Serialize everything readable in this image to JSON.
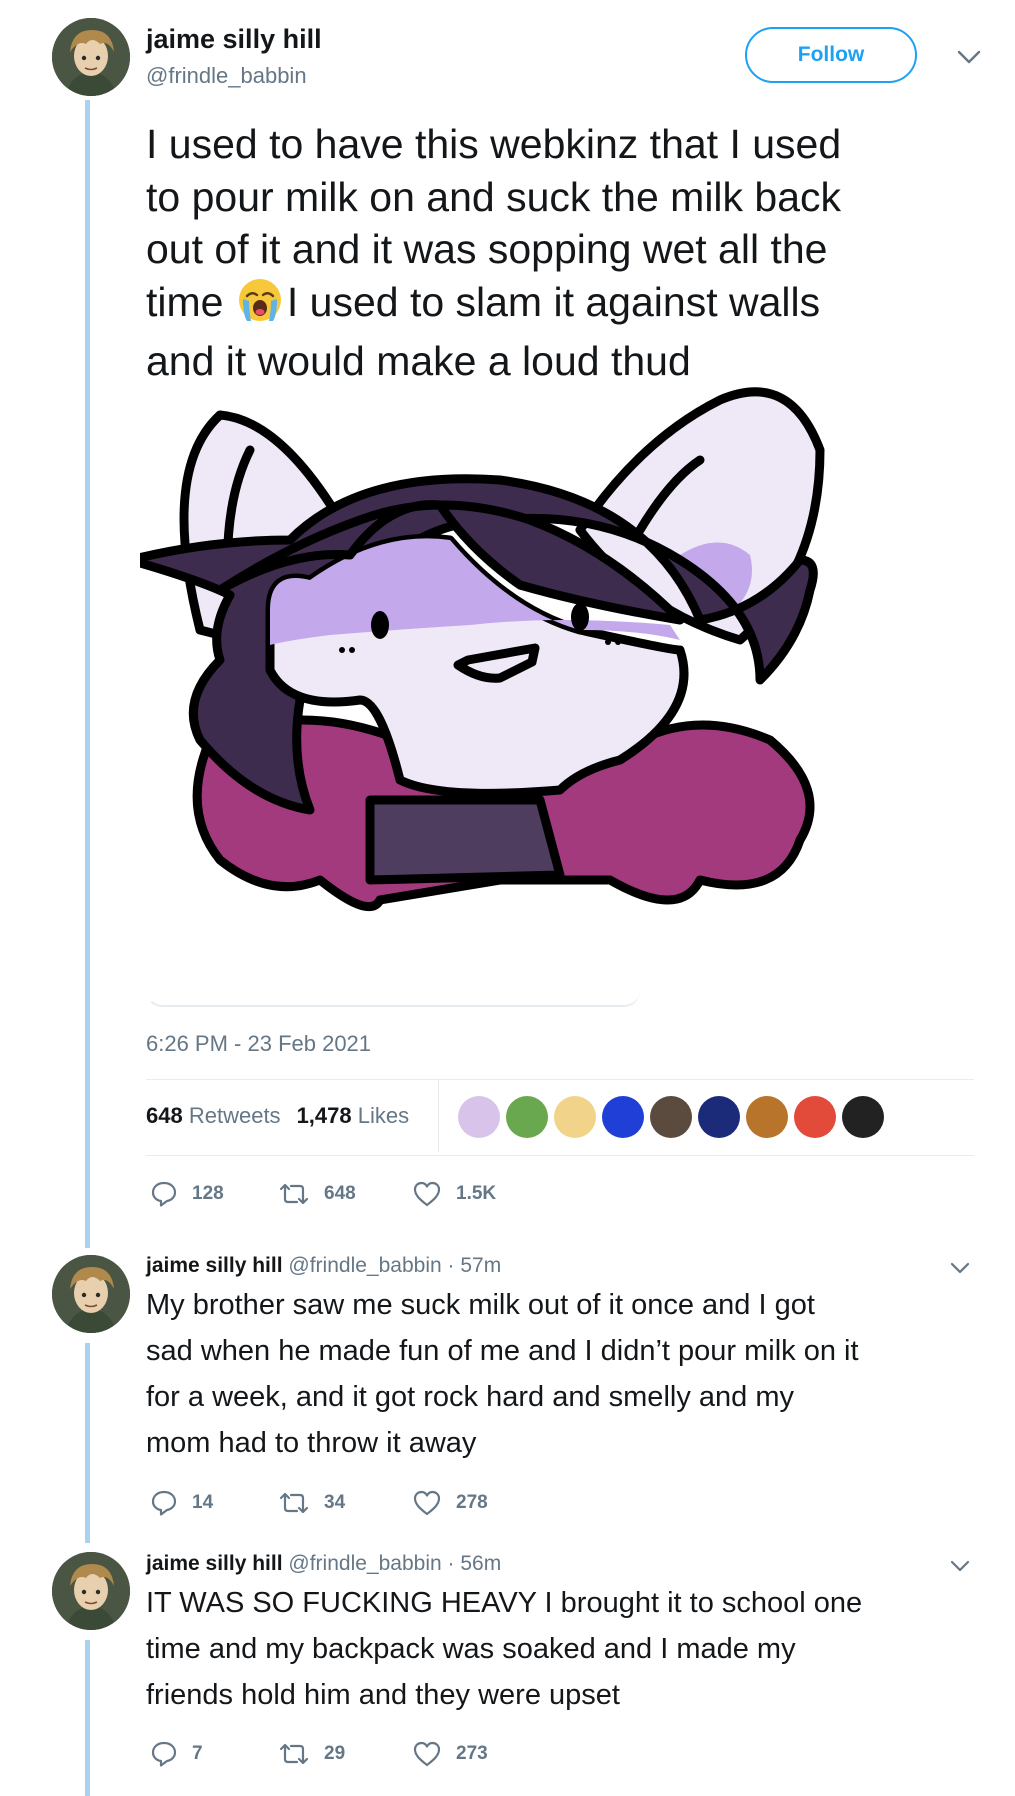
{
  "main_tweet": {
    "author": {
      "display_name": "jaime silly hill",
      "handle": "@frindle_babbin"
    },
    "follow_label": "Follow",
    "text_lines": [
      "I used to have this webkinz that I used",
      "to pour milk on and suck the milk back",
      "out of it and it was sopping wet all the",
      "time ",
      "I used to slam it against walls",
      "and it would make a loud thud"
    ],
    "emoji": "loudly-crying-face",
    "timestamp": "6:26 PM - 23 Feb 2021",
    "retweets_count": "648",
    "retweets_label": "Retweets",
    "likes_count": "1,478",
    "likes_label": "Likes",
    "actions": {
      "replies": "128",
      "retweets": "648",
      "likes": "1.5K"
    }
  },
  "replies": [
    {
      "display_name": "jaime silly hill",
      "handle": "@frindle_babbin",
      "time": "· 57m",
      "text_lines": [
        "My brother saw me suck milk out of it once and I got",
        "sad when he made fun of me and I didn’t pour milk on it",
        "for a week, and it got rock hard and smelly and my",
        "mom had to throw it away"
      ],
      "actions": {
        "replies": "14",
        "retweets": "34",
        "likes": "278"
      }
    },
    {
      "display_name": "jaime silly hill",
      "handle": "@frindle_babbin",
      "time": "· 56m",
      "text_lines": [
        "IT WAS SO FUCKING HEAVY I brought it to school one",
        "time and my backpack was soaked and I made my",
        "friends hold him and they were upset"
      ],
      "actions": {
        "replies": "7",
        "retweets": "29",
        "likes": "273"
      }
    }
  ],
  "colors": {
    "accent": "#1da1f2",
    "thread_line": "#a8d2f0",
    "muted_text": "#657786",
    "hair_dark": "#3d2c4e",
    "hair_magenta": "#a33a7e",
    "face_lavender": "#c4a8ec"
  }
}
